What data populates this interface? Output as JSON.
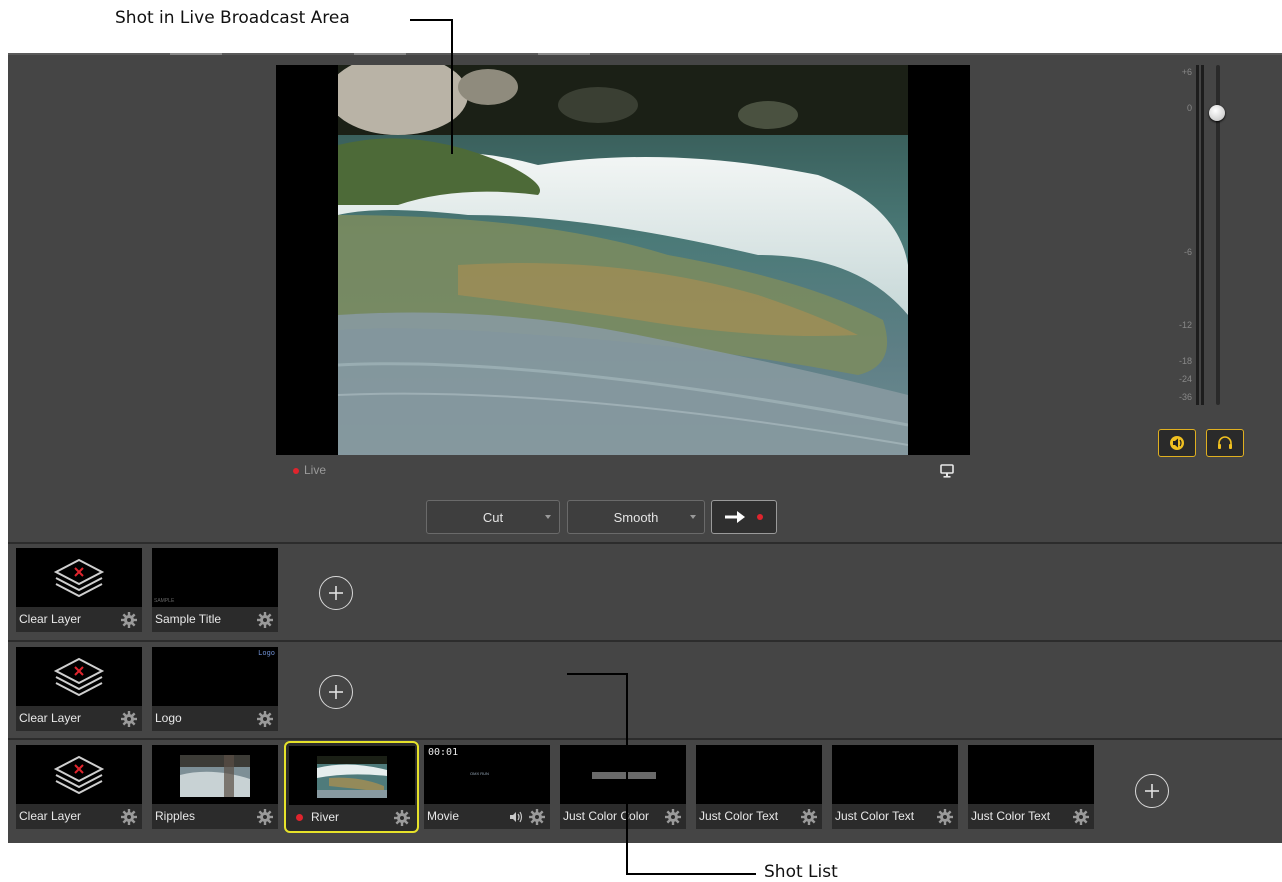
{
  "callouts": {
    "top": "Shot in Live Broadcast Area",
    "bottom": "Shot List"
  },
  "live": {
    "status_label": "Live",
    "monitor_icon": "monitor-icon"
  },
  "transition": {
    "cut_label": "Cut",
    "smooth_label": "Smooth",
    "go_icon": "arrow-right-icon"
  },
  "meter": {
    "ticks": [
      "+6",
      "0",
      "-6",
      "-12",
      "-18",
      "-24",
      "-36"
    ]
  },
  "rows": [
    {
      "shots": [
        {
          "label": "Clear Layer",
          "icon": "clear-layer-icon"
        },
        {
          "label": "Sample Title",
          "thumb_text": "SAMPLE"
        }
      ]
    },
    {
      "shots": [
        {
          "label": "Clear Layer",
          "icon": "clear-layer-icon"
        },
        {
          "label": "Logo",
          "thumb_text": "Logo"
        }
      ]
    },
    {
      "shots": [
        {
          "label": "Clear Layer",
          "icon": "clear-layer-icon"
        },
        {
          "label": "Ripples"
        },
        {
          "label": "River",
          "live": true
        },
        {
          "label": "Movie",
          "timecode": "00:01",
          "thumb_text": "OMX RUN"
        },
        {
          "label": "Just Color Color"
        },
        {
          "label": "Just Color Text"
        },
        {
          "label": "Just Color Text"
        },
        {
          "label": "Just Color Text"
        }
      ]
    }
  ],
  "colors": {
    "app_bg": "#454545",
    "selected_outline": "#e6e22a",
    "live_red": "#e0242d",
    "audio_accent": "#e0b020"
  }
}
